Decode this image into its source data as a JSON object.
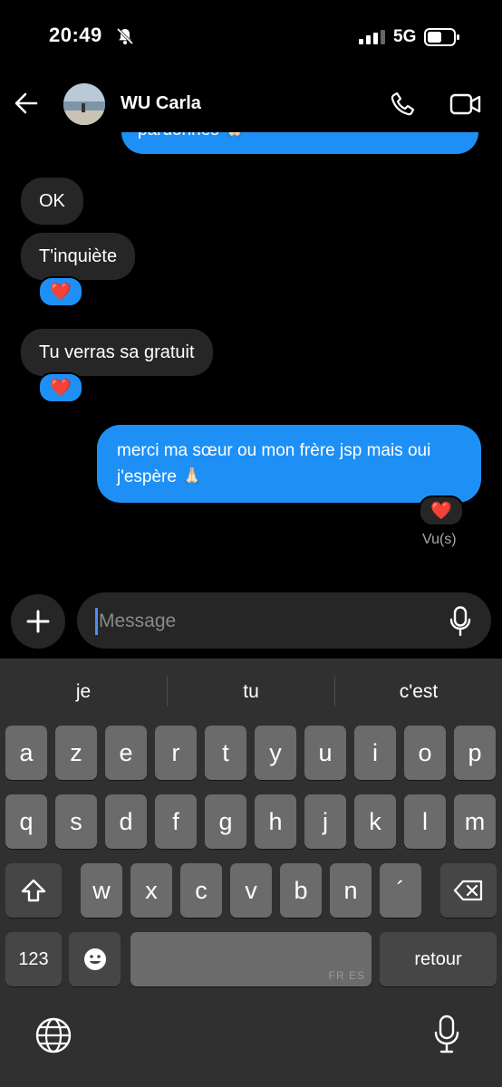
{
  "status_bar": {
    "time": "20:49",
    "network": "5G"
  },
  "header": {
    "contact_name": "WU Carla"
  },
  "chat": {
    "cut_message": "pardonnes 🙏🏻",
    "incoming": [
      {
        "text": "OK",
        "reaction": ""
      },
      {
        "text": "T'inquiète",
        "reaction": "❤️"
      },
      {
        "text": "Tu verras sa gratuit",
        "reaction": "❤️"
      }
    ],
    "outgoing": {
      "text": "merci ma sœur ou mon frère jsp mais oui j'espère 🙏🏻",
      "reaction": "❤️"
    },
    "seen_label": "Vu(s)"
  },
  "composer": {
    "placeholder": "Message"
  },
  "keyboard": {
    "suggestions": [
      "je",
      "tu",
      "c'est"
    ],
    "row1": [
      "a",
      "z",
      "e",
      "r",
      "t",
      "y",
      "u",
      "i",
      "o",
      "p"
    ],
    "row2": [
      "q",
      "s",
      "d",
      "f",
      "g",
      "h",
      "j",
      "k",
      "l",
      "m"
    ],
    "row3": [
      "w",
      "x",
      "c",
      "v",
      "b",
      "n",
      "´"
    ],
    "numbers_label": "123",
    "return_label": "retour",
    "space_sublabel": "FR ES"
  },
  "colors": {
    "accent": "#1e90f5",
    "bubble_in": "#262626",
    "keyboard_bg": "#303030"
  }
}
